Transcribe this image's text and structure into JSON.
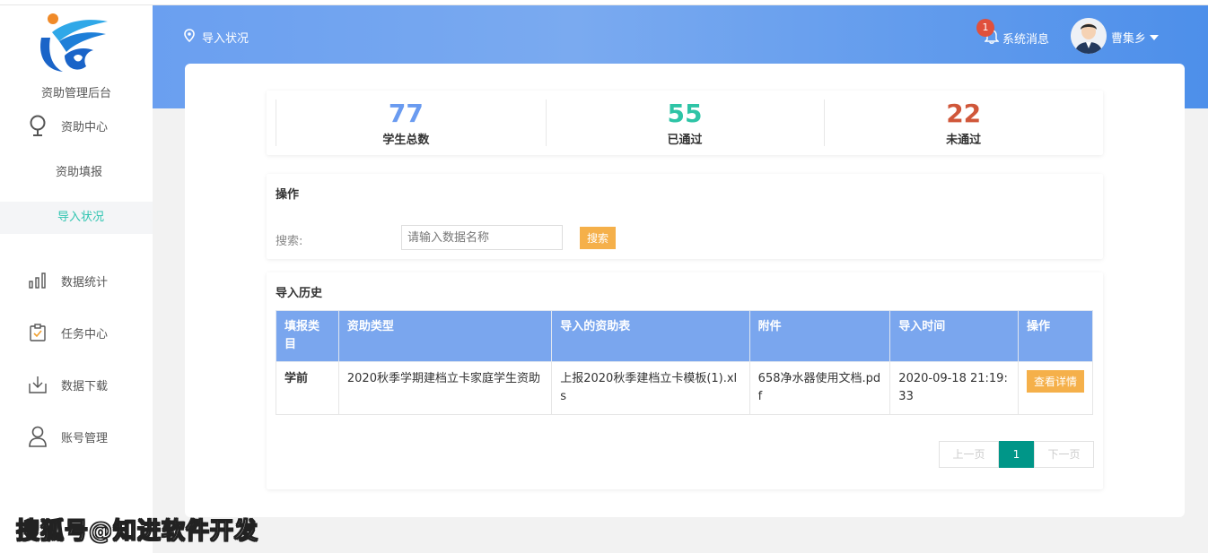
{
  "sidebar": {
    "logo_text": "资助管理后台",
    "items": [
      {
        "label": "资助中心",
        "icon": "map-pin-icon"
      },
      {
        "label": "资助填报"
      },
      {
        "label": "导入状况",
        "active": true
      },
      {
        "label": "数据统计",
        "icon": "bar-chart-icon"
      },
      {
        "label": "任务中心",
        "icon": "clipboard-check-icon"
      },
      {
        "label": "数据下载",
        "icon": "download-icon"
      },
      {
        "label": "账号管理",
        "icon": "user-icon"
      }
    ]
  },
  "header": {
    "breadcrumb": "导入状况",
    "badge_count": "1",
    "messages_label": "系统消息",
    "username": "曹集乡"
  },
  "stats": [
    {
      "value": "77",
      "label": "学生总数",
      "color": "#6a9bf0"
    },
    {
      "value": "55",
      "label": "已通过",
      "color": "#2ec4a6"
    },
    {
      "value": "22",
      "label": "未通过",
      "color": "#d0573a"
    }
  ],
  "operations": {
    "title": "操作",
    "search_label": "搜索:",
    "search_placeholder": "请输入数据名称",
    "search_button": "搜索"
  },
  "history": {
    "title": "导入历史",
    "columns": [
      "填报类目",
      "资助类型",
      "导入的资助表",
      "附件",
      "导入时间",
      "操作"
    ],
    "rows": [
      {
        "category": "学前",
        "type": "2020秋季学期建档立卡家庭学生资助",
        "sheet": "上报2020秋季建档立卡模板(1).xls",
        "attachment": "658净水器使用文档.pdf",
        "time": "2020-09-18 21:19:33",
        "action": "查看详情"
      }
    ]
  },
  "pager": {
    "prev": "上一页",
    "current": "1",
    "next": "下一页"
  },
  "watermark": "搜狐号@知进软件开发"
}
